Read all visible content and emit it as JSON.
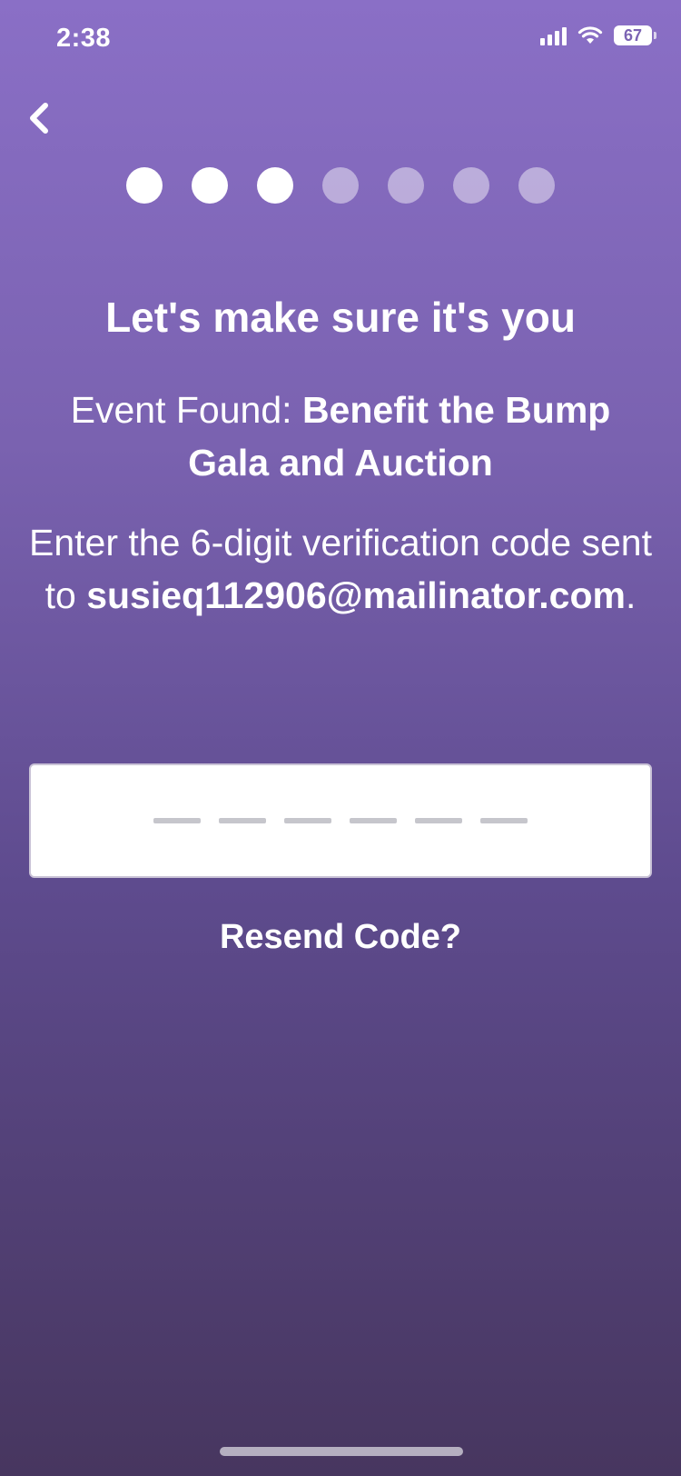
{
  "status_bar": {
    "time": "2:38",
    "battery": "67"
  },
  "progress": {
    "total_steps": 7,
    "completed_steps": 3
  },
  "title": "Let's make sure it's you",
  "event": {
    "prefix": "Event Found: ",
    "name": "Benefit the Bump Gala and Auction"
  },
  "instruction": {
    "text": "Enter the 6-digit verification code sent to ",
    "email": "susieq112906@mailinator.com",
    "suffix": "."
  },
  "code_input": {
    "digits": 6,
    "value": ""
  },
  "resend_label": "Resend Code?"
}
